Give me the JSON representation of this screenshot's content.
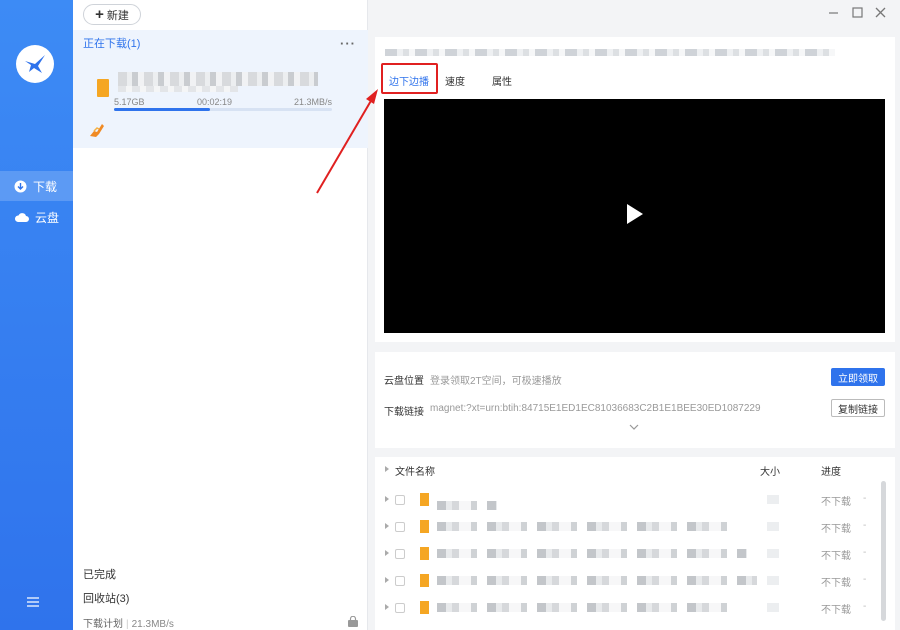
{
  "app": {
    "accent_color": "#2f73ec",
    "rail_color": "#3d8bf5"
  },
  "rail": {
    "nav": [
      {
        "label": "下载",
        "icon": "download-icon",
        "active": true
      },
      {
        "label": "云盘",
        "icon": "cloud-icon",
        "active": false
      }
    ]
  },
  "list": {
    "new_button": "新建",
    "downloading_header": "正在下载(1)",
    "more": "···",
    "task": {
      "size": "5.17GB",
      "remaining": "00:02:19",
      "speed": "21.3MB/s",
      "progress_fraction": 0.44
    },
    "completed": "已完成",
    "recycle": "回收站(3)",
    "plan": "下载计划",
    "plan_sep": "|",
    "plan_rate": "21.3MB/s"
  },
  "detail": {
    "tabs": [
      "边下边播",
      "速度",
      "属性"
    ],
    "active_tab": 0
  },
  "info": {
    "cloud_label": "云盘位置",
    "cloud_value": "登录领取2T空间，可极速播放",
    "claim_button": "立即领取",
    "link_label": "下载链接",
    "link_value": "magnet:?xt=urn:btih:84715E1ED1EC81036683C2B1E1BEE30ED1087229",
    "copy_button": "复制链接"
  },
  "files": {
    "headers": {
      "name": "文件名称",
      "size": "大小",
      "progress": "进度"
    },
    "rows": [
      {
        "status": "不下载",
        "dash": "-"
      },
      {
        "status": "不下载",
        "dash": "-"
      },
      {
        "status": "不下载",
        "dash": "-"
      },
      {
        "status": "不下载",
        "dash": "-"
      },
      {
        "status": "不下载",
        "dash": "-"
      }
    ]
  }
}
